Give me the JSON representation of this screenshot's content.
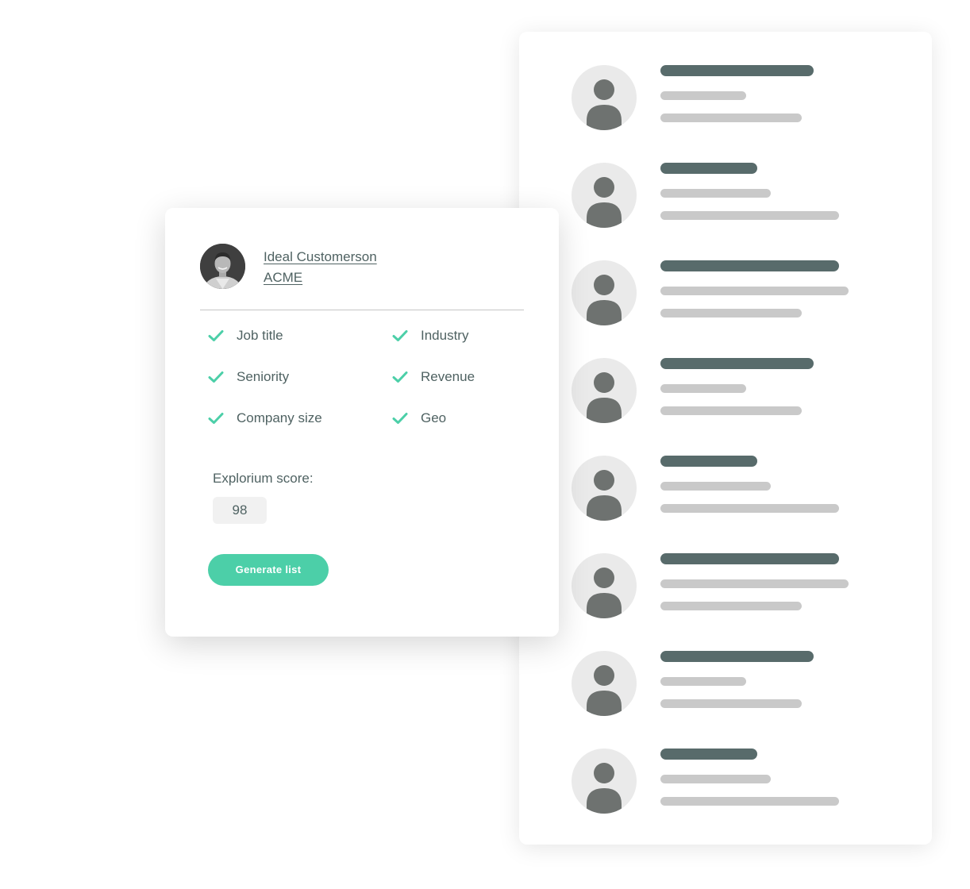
{
  "profile": {
    "name": "Ideal Customerson",
    "company": "ACME"
  },
  "criteria": [
    {
      "label": "Job title",
      "checked": true
    },
    {
      "label": "Industry",
      "checked": true
    },
    {
      "label": "Seniority",
      "checked": true
    },
    {
      "label": "Revenue",
      "checked": true
    },
    {
      "label": "Company size",
      "checked": true
    },
    {
      "label": "Geo",
      "checked": true
    }
  ],
  "score": {
    "label": "Explorium score:",
    "value": "98"
  },
  "actions": {
    "generate_label": "Generate list"
  },
  "results_list": {
    "item_count": 8,
    "placeholder_icon": "user-icon"
  },
  "colors": {
    "accent": "#4ccfa8",
    "text": "#4f6262",
    "skeleton_dark": "#586b6b",
    "skeleton_light": "#c9c9c9",
    "avatar_bg": "#eaeaea",
    "avatar_fg": "#6e7270"
  }
}
